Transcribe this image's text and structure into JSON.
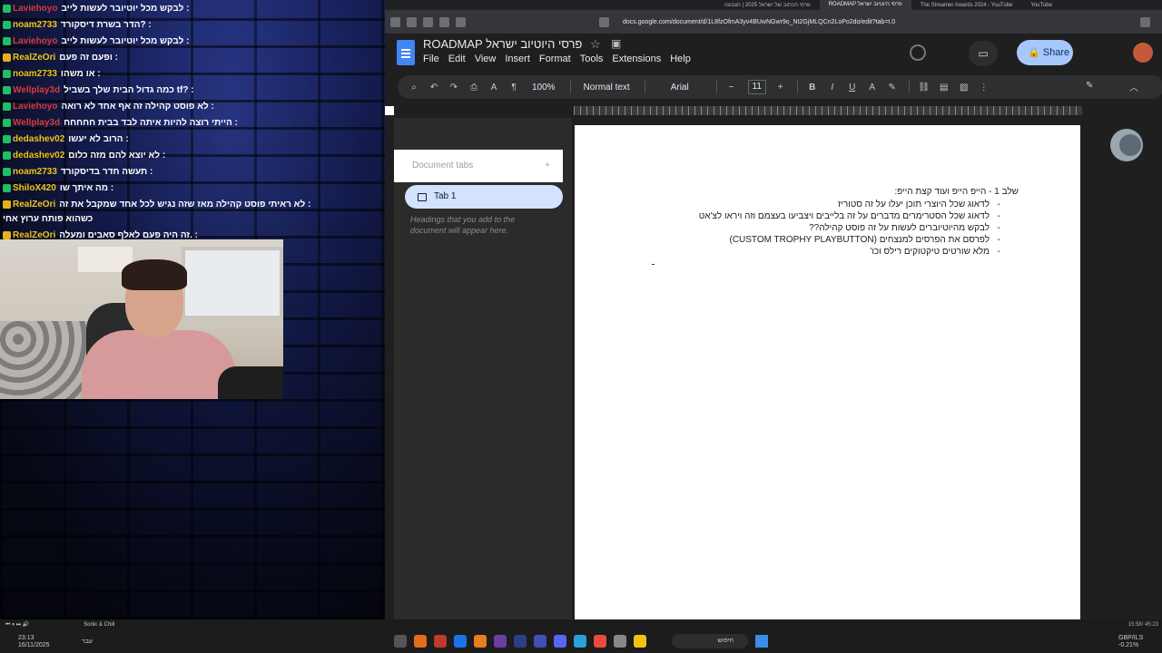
{
  "chat": {
    "messages": [
      {
        "user": "Laviehoyo",
        "user_color": "#d63b3b",
        "text": "לבקש מכל יוטיובר לעשות לייב :",
        "badge": "green"
      },
      {
        "user": "noam2733",
        "user_color": "#f0c419",
        "text": "הדר בשרת דיסקורד? :",
        "badge": "green"
      },
      {
        "user": "Laviehoyo",
        "user_color": "#d63b3b",
        "text": "לבקש מכל יוטיובר לעשות לייב :",
        "badge": "green"
      },
      {
        "user": "RealZeOri",
        "user_color": "#f0c419",
        "text": "ופעם זה פעם :",
        "badge": "gold"
      },
      {
        "user": "noam2733",
        "user_color": "#f0c419",
        "text": "או משהו :",
        "badge": "green"
      },
      {
        "user": "Wellplay3d",
        "user_color": "#d63b3b",
        "text": "כמה גדול הבית שלך בשביל tf? :",
        "badge": "green"
      },
      {
        "user": "Laviehoyo",
        "user_color": "#d63b3b",
        "text": "לא פוסט קהילה זה אף אחד לא רואה :",
        "badge": "green"
      },
      {
        "user": "Wellplay3d",
        "user_color": "#d63b3b",
        "text": "הייתי רוצה להיות איתה לבד בבית חחחחח :",
        "badge": "green"
      },
      {
        "user": "dedashev02",
        "user_color": "#f0c419",
        "text": "הרוב לא יעשו :",
        "badge": "green"
      },
      {
        "user": "dedashev02",
        "user_color": "#f0c419",
        "text": "לא יוצא להם מזה כלום :",
        "badge": "green"
      },
      {
        "user": "noam2733",
        "user_color": "#f0c419",
        "text": "תעשה חדר בדיסקורד :",
        "badge": "green"
      },
      {
        "user": "ShiloX420",
        "user_color": "#f0c419",
        "text": "מה איתך שו :",
        "badge": "green"
      },
      {
        "user": "RealZeOri",
        "user_color": "#f0c419",
        "text": "לא ראיתי פוסט קהילה מאז שזה נגיש לכל אחד שמקבל את זה :",
        "badge": "gold"
      }
    ],
    "wrap_line": "כשהוא פותח ערוץ אחי",
    "last": {
      "user": "RealZeOri",
      "user_color": "#f0c419",
      "text": "זה היה פעם לאלף סאבים ומעלה. :",
      "badge": "gold"
    }
  },
  "browser": {
    "tabs": [
      "פרסי הכתוב של ישראל 2025 | הצבעה",
      "ROADMAP פרסי היוטיוב ישראל",
      "The Streamer Awards 2024 - YouTube",
      "YouTube"
    ],
    "url": "docs.google.com/document/d/1L8fzOfmA3yv4BUwNGwr9o_Nt2GjMLQCn2LoPo2do/edit?tab=t.0"
  },
  "doc": {
    "title": "ROADMAP פרסי היוטיוב ישראל",
    "menu": [
      "File",
      "Edit",
      "View",
      "Insert",
      "Format",
      "Tools",
      "Extensions",
      "Help"
    ],
    "share_label": "Share",
    "toolbar": {
      "zoom": "100%",
      "style": "Normal text",
      "font": "Arial",
      "size": "11"
    },
    "tabs_header": "Document tabs",
    "tab1": "Tab 1",
    "hint": "Headings that you add to the document will appear here.",
    "heading": "שלב 1 - הייפ הייפ ועוד קצת הייפ:",
    "bullets": [
      "לדאוג שכל היוצרי תוכן יעלו על זה סטוריז",
      "לדאוג שכל הסטרימרים מדברים על זה בלייבים ויצביעו בעצמם וזה ויראו לצ'אט",
      "לבקש מהיוטיוברים לעשות על זה פוסט קהילה??",
      "לפרסם את הפרסים למנצחים (CUSTOM TROPHY PLAYBUTTON)",
      "מלא שורטים טיקטוקים רילס וכו'"
    ],
    "bullet_mark": "-"
  },
  "media": {
    "song": "Sonic & Chill",
    "clock": "15:58/ 45:23"
  },
  "taskbar": {
    "time": "23:13",
    "date": "16/11/2025",
    "lang": "עבר",
    "search": "חיפוש",
    "currency": "GBP/ILS",
    "change": "-0.21%"
  }
}
